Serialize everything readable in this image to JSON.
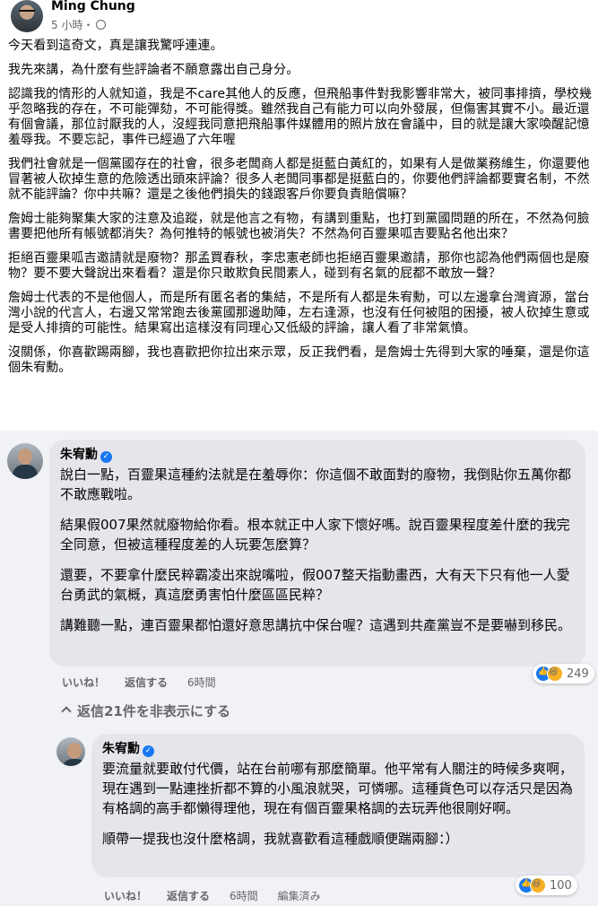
{
  "post": {
    "author": "Ming Chung",
    "time": "5 小時・",
    "paragraphs": [
      "今天看到這奇文，真是讓我驚呼連連。",
      "我先來講，為什麼有些評論者不願意露出自己身分。",
      "認識我的情形的人就知道，我是不care其他人的反應，但飛船事件對我影響非常大，被同事排擠，學校幾乎忽略我的存在，不可能彈劾，不可能得獎。雖然我自己有能力可以向外發展，但傷害其實不小。最近還有個會議，那位討厭我的人，沒經我同意把飛船事件媒體用的照片放在會議中，目的就是讓大家喚醒記憶羞辱我。不要忘記，事件已經過了六年喔",
      "我們社會就是一個黨國存在的社會，很多老闆商人都是挺藍白黃紅的，如果有人是做業務維生，你還要他冒著被人砍掉生意的危險透出頭來評論？很多人老闆同事都是挺藍白的，你要他們評論都要實名制，不然就不能評論？你中共嘛？還是之後他們損失的錢跟客戶你要負責賠償嘛？",
      "詹姆士能夠聚集大家的注意及追蹤，就是他言之有物，有講到重點，也打到黨國問題的所在，不然為何臉書要把他所有帳號都消失？為何推特的帳號也被消失？不然為何百靈果呱吉要點名他出來？",
      "拒絕百靈果呱吉邀請就是廢物？那孟買春秋，李忠憲老師也拒絕百靈果邀請，那你也認為他們兩個也是廢物？要不要大聲說出來看看？還是你只敢欺負民間素人，碰到有名氣的屁都不敢放一聲？",
      "詹姆士代表的不是他個人，而是所有匿名者的集結，不是所有人都是朱宥勳，可以左邊拿台灣資源，當台灣小說的代言人，右邊又常常跑去後黨國那邊助陣，左右逢源，也沒有任何被阻的困擾，被人砍掉生意或是受人排擠的可能性。結果寫出這樣沒有同理心又低級的評論，讓人看了非常氣憤。",
      "沒關係，你喜歡踢兩腳，我也喜歡把你拉出來示眾，反正我們看，是詹姆士先得到大家的唾棄，還是你這個朱宥勳。"
    ]
  },
  "comment1": {
    "author": "朱宥勳",
    "paragraphs": [
      "說白一點，百靈果這種約法就是在羞辱你：你這個不敢面對的廢物，我倒貼你五萬你都不敢應戰啦。",
      "結果假007果然就廢物給你看。根本就正中人家下懷好嗎。說百靈果程度差什麼的我完全同意，但被這種程度差的人玩要怎麼算？",
      "還要，不要拿什麼民粹霸凌出來說嘴啦，假007整天指動畫西，大有天下只有他一人愛台勇武的氣概，真這麼勇害怕什麼區區民粹？",
      "講難聽一點，連百靈果都怕還好意思講抗中保台喔？這遇到共產黨豈不是要嚇到移民。"
    ],
    "like_label": "いいね！",
    "reply_label": "返信する",
    "time": "6時間",
    "reaction_count": "249"
  },
  "hide_replies_label": "返信21件を非表示にする",
  "comment2": {
    "author": "朱宥勳",
    "paragraphs": [
      "要流量就要敢付代價，站在台前哪有那麼簡單。他平常有人關注的時候多爽啊，現在遇到一點連挫折都不算的小風浪就哭，可憐哪。這種貨色可以存活只是因為有格調的高手都懶得理他，現在有個百靈果格調的去玩弄他很剛好啊。",
      "順帶一提我也沒什麼格調，我就喜歡看這種戲順便踹兩腳：）"
    ],
    "like_label": "いいね！",
    "reply_label": "返信する",
    "time": "6時間",
    "edited_label": "編集済み",
    "reaction_count": "100"
  },
  "colors": {
    "accent": "#1877f2",
    "secondary_text": "#65676b",
    "bubble_bg": "#e4e6eb",
    "comment_bg": "#f0f2f5"
  }
}
